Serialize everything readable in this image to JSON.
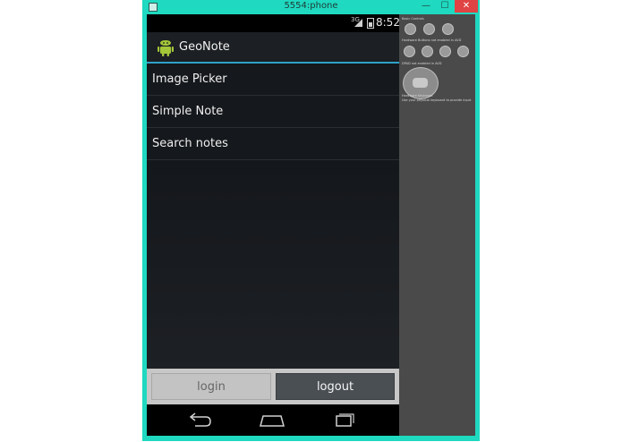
{
  "window": {
    "title": "5554:phone",
    "min_label": "—",
    "max_label": "☐",
    "close_label": "✕"
  },
  "statusbar": {
    "network": "3G",
    "time": "8:52"
  },
  "app": {
    "title": "GeoNote",
    "logo_icon": "android-robot-icon"
  },
  "menu": {
    "items": [
      {
        "label": "Image Picker"
      },
      {
        "label": "Simple Note"
      },
      {
        "label": "Search notes"
      }
    ]
  },
  "buttons": {
    "login": "login",
    "logout": "logout"
  },
  "navbar": {
    "back_icon": "back-icon",
    "home_icon": "home-icon",
    "recent_icon": "recent-apps-icon"
  },
  "controls": {
    "basic_label": "Basic Controls",
    "hardware_label": "Hardware Buttons not enabled in AVD",
    "dpad_label": "DPAD not enabled in AVD",
    "keyboard_label": "Hardware Keyboard",
    "keyboard_hint": "Use your physical keyboard to provide input"
  },
  "colors": {
    "window_frame": "#1fd9c0",
    "accent": "#2ea2c9",
    "close": "#e04343"
  }
}
